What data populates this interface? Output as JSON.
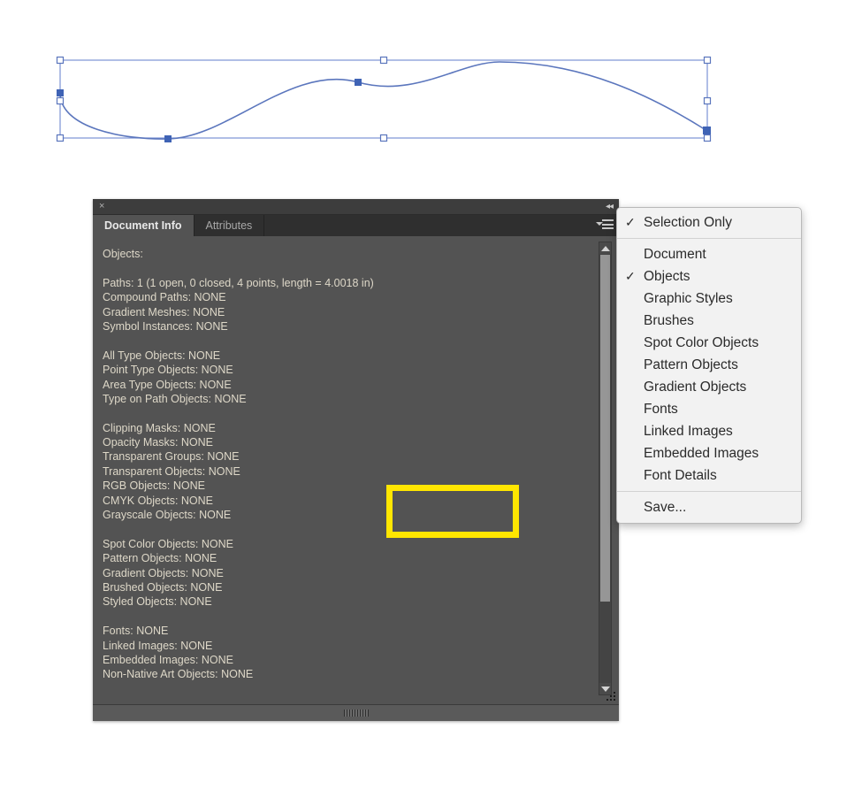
{
  "artwork": {
    "name": "bezier-sine-path",
    "description": "Selected open bezier path forming an S / sine curve with 4 anchor points and a bounding box with selection handles",
    "stroke_color": "#5b76bd",
    "bbox_color": "#7b93d4",
    "anchor_fill": "#3f63b5",
    "handle_fill": "#ffffff"
  },
  "panel": {
    "close_icon": "×",
    "collapse_icon": "◂◂",
    "tabs": [
      {
        "label": "Document Info",
        "active": true
      },
      {
        "label": "Attributes",
        "active": false
      }
    ],
    "menu_icon": "panel-menu-icon",
    "info_lines": [
      "Objects:",
      "",
      "Paths: 1 (1 open, 0 closed, 4 points, length = 4.0018 in)",
      "Compound Paths: NONE",
      "Gradient Meshes: NONE",
      "Symbol Instances: NONE",
      "",
      "All Type Objects: NONE",
      "Point Type Objects: NONE",
      "Area Type Objects: NONE",
      "Type on Path Objects: NONE",
      "",
      "Clipping Masks: NONE",
      "Opacity Masks: NONE",
      "Transparent Groups: NONE",
      "Transparent Objects: NONE",
      "RGB Objects: NONE",
      "CMYK Objects: NONE",
      "Grayscale Objects: NONE",
      "",
      "Spot Color Objects: NONE",
      "Pattern Objects: NONE",
      "Gradient Objects: NONE",
      "Brushed Objects: NONE",
      "Styled Objects: NONE",
      "",
      "Fonts: NONE",
      "Linked Images: NONE",
      "Embedded Images: NONE",
      "Non-Native Art Objects: NONE"
    ],
    "highlight": {
      "color": "#ffe600",
      "highlighted_text": ", length = 4.0018 in)"
    },
    "text_color": "#ded8c8",
    "background_color": "#535353"
  },
  "flyout_menu": {
    "items": [
      {
        "label": "Selection Only",
        "checked": true,
        "separator_after": true
      },
      {
        "label": "Document",
        "checked": false,
        "separator_after": false
      },
      {
        "label": "Objects",
        "checked": true,
        "separator_after": false
      },
      {
        "label": "Graphic Styles",
        "checked": false,
        "separator_after": false
      },
      {
        "label": "Brushes",
        "checked": false,
        "separator_after": false
      },
      {
        "label": "Spot Color Objects",
        "checked": false,
        "separator_after": false
      },
      {
        "label": "Pattern Objects",
        "checked": false,
        "separator_after": false
      },
      {
        "label": "Gradient Objects",
        "checked": false,
        "separator_after": false
      },
      {
        "label": "Fonts",
        "checked": false,
        "separator_after": false
      },
      {
        "label": "Linked Images",
        "checked": false,
        "separator_after": false
      },
      {
        "label": "Embedded Images",
        "checked": false,
        "separator_after": false
      },
      {
        "label": "Font Details",
        "checked": false,
        "separator_after": true
      },
      {
        "label": "Save...",
        "checked": false,
        "separator_after": false
      }
    ],
    "check_glyph": "✓",
    "background_color": "#f2f2f2"
  }
}
